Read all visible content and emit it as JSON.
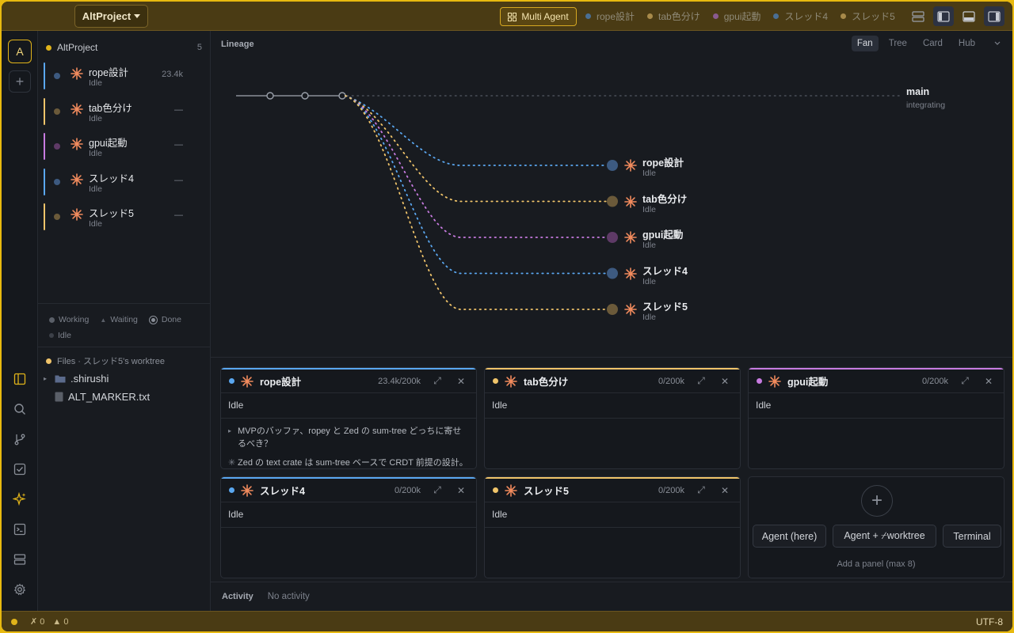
{
  "titlebar": {
    "project_name": "AltProject",
    "multi_agent_label": "Multi Agent",
    "threads": [
      {
        "label": "rope設計",
        "color": "#4a79b8"
      },
      {
        "label": "tab色分け",
        "color": "#a88a4a"
      },
      {
        "label": "gpui起動",
        "color": "#8a5a8f"
      },
      {
        "label": "スレッド4",
        "color": "#4a79b8"
      },
      {
        "label": "スレッド5",
        "color": "#a88a4a"
      }
    ]
  },
  "rail": {
    "avatar_letter": "A",
    "add_label": "+"
  },
  "sidebar": {
    "project": {
      "name": "AltProject",
      "count": "5",
      "color": "#e0b31a"
    },
    "threads": [
      {
        "name": "rope設計",
        "status": "Idle",
        "meta": "23.4k",
        "bar_color": "#5aa7f0",
        "dot_color": "#3d5a80"
      },
      {
        "name": "tab色分け",
        "status": "Idle",
        "meta": "—",
        "bar_color": "#f0c46a",
        "dot_color": "#6b5a3a"
      },
      {
        "name": "gpui起動",
        "status": "Idle",
        "meta": "—",
        "bar_color": "#c77be0",
        "dot_color": "#5e3a66"
      },
      {
        "name": "スレッド4",
        "status": "Idle",
        "meta": "—",
        "bar_color": "#5aa7f0",
        "dot_color": "#3d5a80"
      },
      {
        "name": "スレッド5",
        "status": "Idle",
        "meta": "—",
        "bar_color": "#f0c46a",
        "dot_color": "#6b5a3a"
      }
    ],
    "legend": {
      "working": "Working",
      "waiting": "Waiting",
      "done": "Done",
      "idle": "Idle"
    },
    "files": {
      "header": "Files · スレッド5's worktree",
      "items": [
        {
          "name": ".shirushi",
          "type": "folder"
        },
        {
          "name": "ALT_MARKER.txt",
          "type": "file"
        }
      ]
    }
  },
  "main": {
    "lineage_title": "Lineage",
    "view_tabs": [
      "Fan",
      "Tree",
      "Card",
      "Hub"
    ],
    "active_tab": "Fan",
    "main_node": {
      "name": "main",
      "status": "integrating"
    },
    "branches": [
      {
        "name": "rope設計",
        "status": "Idle",
        "color": "#5aa7f0",
        "node_color": "#3d5a80"
      },
      {
        "name": "tab色分け",
        "status": "Idle",
        "color": "#f0c46a",
        "node_color": "#6b5a3a"
      },
      {
        "name": "gpui起動",
        "status": "Idle",
        "color": "#c77be0",
        "node_color": "#5e3a66"
      },
      {
        "name": "スレッド4",
        "status": "Idle",
        "color": "#5aa7f0",
        "node_color": "#3d5a80"
      },
      {
        "name": "スレッド5",
        "status": "Idle",
        "color": "#f0c46a",
        "node_color": "#6b5a3a"
      }
    ],
    "panels": [
      {
        "title": "rope設計",
        "tokens": "23.4k/200k",
        "status": "Idle",
        "accent": "#5aa7f0",
        "messages": [
          "MVPのバッファ、ropey と Zed の sum-tree どっちに寄せるべき？",
          "Zed の text crate は sum-tree ベースで CRDT 前提の設計。"
        ]
      },
      {
        "title": "tab色分け",
        "tokens": "0/200k",
        "status": "Idle",
        "accent": "#f0c46a",
        "messages": []
      },
      {
        "title": "gpui起動",
        "tokens": "0/200k",
        "status": "Idle",
        "accent": "#c77be0",
        "messages": []
      },
      {
        "title": "スレッド4",
        "tokens": "0/200k",
        "status": "Idle",
        "accent": "#5aa7f0",
        "messages": []
      },
      {
        "title": "スレッド5",
        "tokens": "0/200k",
        "status": "Idle",
        "accent": "#f0c46a",
        "messages": []
      }
    ],
    "add_panel": {
      "buttons": [
        "Agent (here)",
        "Agent + ⌿worktree",
        "Terminal"
      ],
      "hint": "Add a panel (max 8)"
    },
    "activity": {
      "label": "Activity",
      "value": "No activity"
    }
  },
  "statusbar": {
    "errors": "0",
    "warnings": "0",
    "encoding": "UTF-8"
  }
}
